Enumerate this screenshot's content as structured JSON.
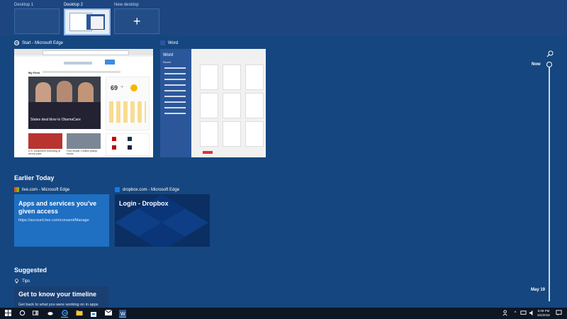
{
  "desktops": [
    {
      "label": "Desktop 1"
    },
    {
      "label": "Desktop 2"
    },
    {
      "label": "New desktop"
    }
  ],
  "windows": {
    "edge_title": "Start - Microsoft Edge",
    "word_title": "Word",
    "word_pane_title": "Word",
    "word_pane_sub": "Recent",
    "edge_news_header": "My Feed",
    "edge_weather_temp": "69",
    "edge_weather_unit": "°F",
    "edge_headline": "States deal blow to ObamaCare",
    "edge_story1": "U.S. consumers borrowing at record pace",
    "edge_story2": "Ford recalls 1 million pickup trucks"
  },
  "earlier_today": {
    "heading": "Earlier Today",
    "cards": [
      {
        "source": "live.com - Microsoft Edge",
        "title": "Apps and services you've given access",
        "url": "https://account.live.com/consent/Manage"
      },
      {
        "source": "dropbox.com - Microsoft Edge",
        "title": "Login - Dropbox"
      }
    ]
  },
  "suggested": {
    "heading": "Suggested",
    "tips_label": "Tips",
    "card_title": "Get to know your timeline",
    "card_sub": "Get back to what you were working on in apps"
  },
  "timeline": {
    "now_label": "Now",
    "date_label": "May 19"
  },
  "taskbar": {
    "time": "6:09 PM",
    "date": "6/2/2018"
  }
}
